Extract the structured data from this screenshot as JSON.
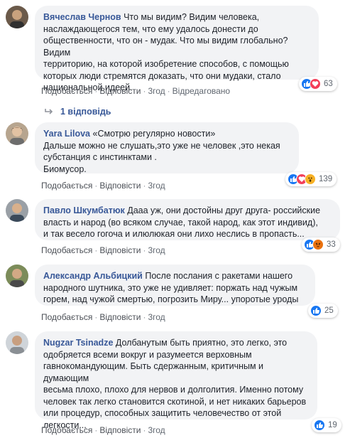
{
  "comments": [
    {
      "author": "Вячеслав Чернов",
      "text": "Что мы видим? Видим человека,\nнаслаждающегося тем, что ему удалось донести до\nобщественности, что он - мудак. Что мы видим глобально? Видим\nтерриторию, на которой изобретение способов, с помощью\nкоторых люди стремятся доказать, что они мудаки, стало\nнациональной идеей.",
      "like_label": "Подобається",
      "reply_label": "Відповісти",
      "time": "3год",
      "edited": "Відредаговано",
      "reaction_count": "63",
      "reactions": [
        "like",
        "love"
      ]
    },
    {
      "author": "Yara Lilova",
      "text": "«Смотрю регулярно новости»\nДальше можно не слушать,это уже не человек ,это некая\nсубстанция с инстинктами .\nБиомусор.",
      "like_label": "Подобається",
      "reply_label": "Відповісти",
      "time": "3год",
      "reaction_count": "139",
      "reactions": [
        "like",
        "love",
        "wow"
      ]
    },
    {
      "author": "Павло Шкумбатюк",
      "text": "Дааа уж, они достойны друг друга- российские\nвласть и народ (во всяком случае, такой народ, как этот индивид),\nи так весело гогоча и илюлюкая они лихо неслись в пропасть...",
      "like_label": "Подобається",
      "reply_label": "Відповісти",
      "time": "3год",
      "reaction_count": "33",
      "reactions": [
        "like",
        "angry"
      ]
    },
    {
      "author": "Александр Альбицкий",
      "text": "После послания с ракетами нашего\nнародного шутника, это уже не удивляет: поржать над чужым\nгорем, над чужой смертью, погрозить Миру... упоротые уроды",
      "like_label": "Подобається",
      "reply_label": "Відповісти",
      "time": "3год",
      "reaction_count": "25",
      "reactions": [
        "like"
      ]
    },
    {
      "author": "Nugzar Tsinadze",
      "text": "Долбанутым быть приятно, это легко, это\nодобряется всеми вокруг и разумеется верховным\nгавнокомандующим. Быть сдержанным, критичным и думающим\nвесьма плохо, плохо для нервов и долголития. Именно потому\nчеловек так легко становится скотиной, и нет никаких барьеров\nили процедур, способных защитить человечество от этой\nлегкости...",
      "like_label": "Подобається",
      "reply_label": "Відповісти",
      "time": "3год",
      "reaction_count": "19",
      "reactions": [
        "like"
      ]
    }
  ],
  "replies_label": "1 відповідь",
  "separator": "·"
}
